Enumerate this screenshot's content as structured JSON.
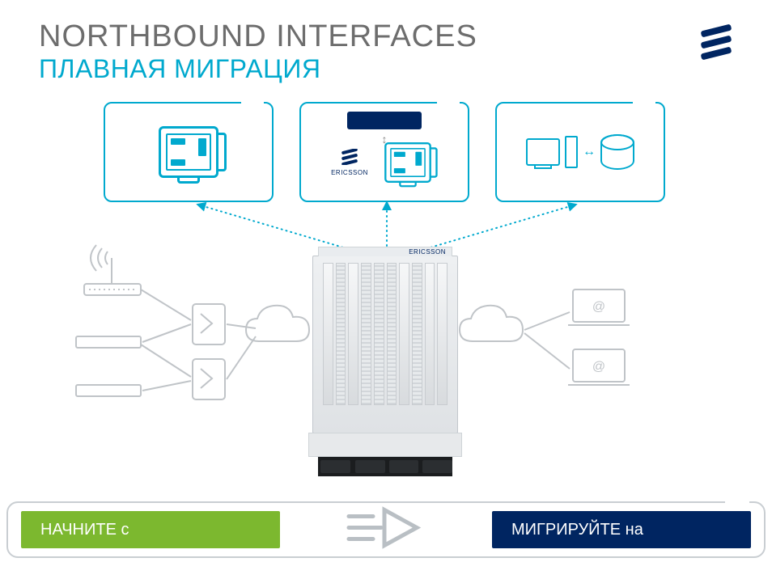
{
  "header": {
    "title": "Northbound interfaces",
    "subtitle": "Плавная миграция"
  },
  "brand": {
    "name": "Ericsson",
    "label_small": "ERICSSON",
    "logo_color": "#002561"
  },
  "boxes": {
    "left": {
      "icon": "dashboard-icon"
    },
    "center": {
      "icon": "dashboard-icon",
      "vendor_label": "ERICSSON"
    },
    "right": {
      "icon": "pc-database-icon"
    }
  },
  "chassis": {
    "brand_label": "ERICSSON"
  },
  "icons": {
    "antenna": "antenna-icon",
    "router": "router-icon",
    "switch": "switch-icon",
    "cloud": "cloud-icon",
    "laptop_at": "@",
    "double_arrow": "↕",
    "sync_arrow": "↔"
  },
  "bottom": {
    "start_label": "НАЧНИТЕ с",
    "migrate_label": "МИГРИРУЙТЕ на"
  },
  "colors": {
    "accent_cyan": "#00a9ce",
    "accent_green": "#7cb82f",
    "accent_navy": "#002561",
    "text_grey": "#6d6d6d",
    "line_grey": "#c0c4c8"
  }
}
